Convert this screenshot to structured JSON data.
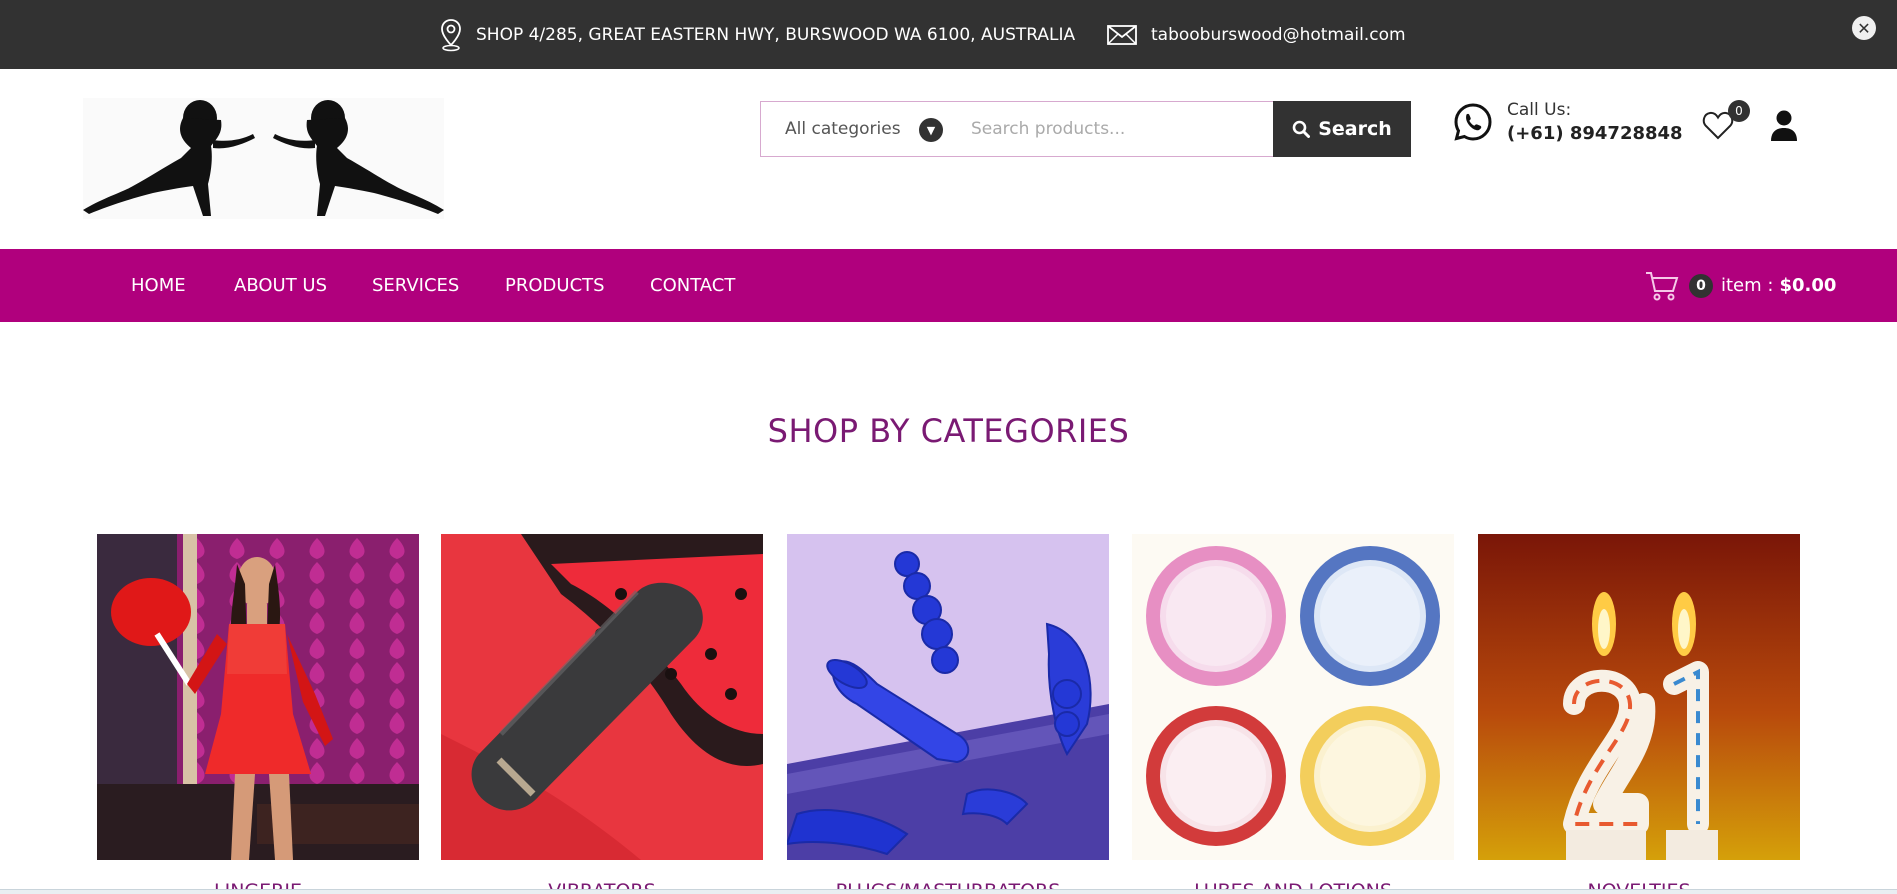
{
  "topbar": {
    "address": "SHOP 4/285, GREAT EASTERN HWY, BURSWOOD WA 6100, AUSTRALIA",
    "email": "tabooburswood@hotmail.com",
    "location_icon": "map-pin-icon",
    "email_icon": "envelope-icon",
    "close_icon": "close-icon"
  },
  "header": {
    "search": {
      "category": "All categories",
      "placeholder": "Search products...",
      "button_label": "Search"
    },
    "call": {
      "label": "Call Us:",
      "number": "(+61) 894728848"
    },
    "wishlist_count": "0"
  },
  "nav": {
    "items": [
      {
        "label": "HOME"
      },
      {
        "label": "ABOUT US"
      },
      {
        "label": "SERVICES"
      },
      {
        "label": "PRODUCTS"
      },
      {
        "label": "CONTACT"
      }
    ],
    "cart": {
      "count": "0",
      "text": "item :",
      "total": "$0.00"
    }
  },
  "categories": {
    "title": "SHOP BY CATEGORIES",
    "items": [
      {
        "label": "LINGERIE"
      },
      {
        "label": "VIBRATORS"
      },
      {
        "label": "PLUGS/MASTURBATORS"
      },
      {
        "label": "LUBES AND LOTIONS"
      },
      {
        "label": "NOVELTIES"
      }
    ]
  },
  "colors": {
    "topbar": "#323232",
    "accent": "#b0007d",
    "title": "#7a1a73"
  }
}
